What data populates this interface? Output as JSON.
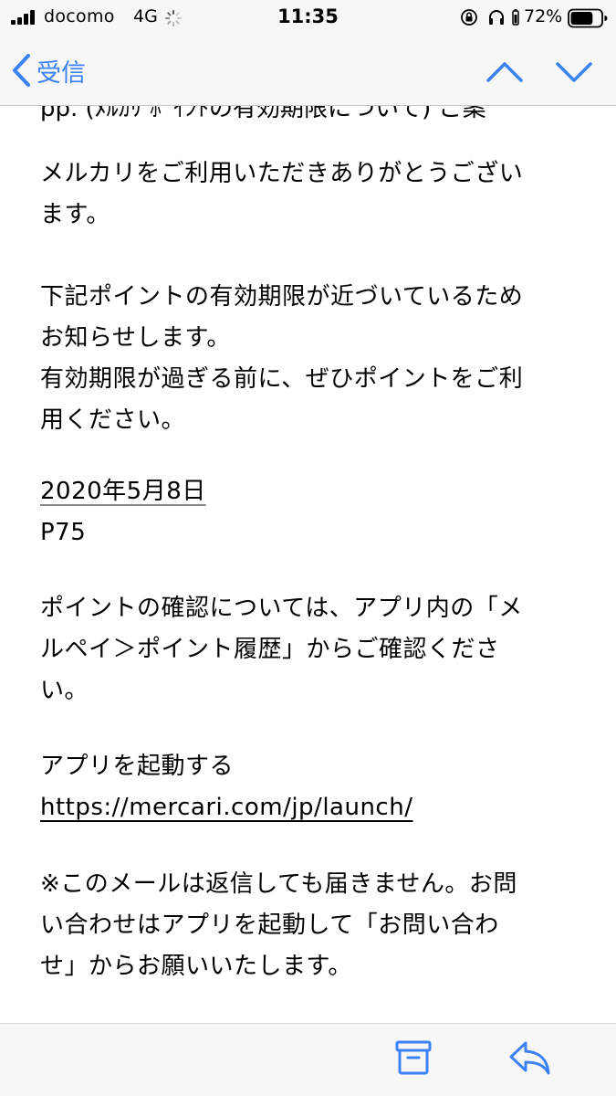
{
  "status_bar": {
    "carrier": "docomo",
    "network": "4G",
    "time": "11:35",
    "battery_percent": "72%",
    "battery_level": 0.72,
    "icons": [
      "signal-icon",
      "activity-icon",
      "orientation-lock-icon",
      "headphones-icon",
      "battery-icon"
    ]
  },
  "nav": {
    "back_label": "受信",
    "back_icon": "chevron-left-icon",
    "up_icon": "chevron-up-icon",
    "down_icon": "chevron-down-icon",
    "accent_color": "#3b82f6"
  },
  "mail": {
    "partial_top_line": "pp. (ﾒﾙｶﾘ ﾎﾟｲﾝﾄの有効期限について) ご案",
    "greeting": [
      "メルカリをご利用いただきありがとうござい",
      "ます。"
    ],
    "notice": [
      "下記ポイントの有効期限が近づいているため",
      "お知らせします。",
      "有効期限が過ぎる前に、ぜひポイントをご利",
      "用ください。"
    ],
    "expiry_date": "2020年5月8日",
    "points": "P75",
    "confirm": [
      "ポイントの確認については、アプリ内の「メ",
      "ルペイ＞ポイント履歴」からご確認くださ",
      "い。"
    ],
    "launch_label": "アプリを起動する",
    "launch_url": "https://mercari.com/jp/launch/",
    "footer": [
      "※このメールは返信しても届きません。お問",
      "い合わせはアプリを起動して「お問い合わ",
      "せ」からお願いいたします。"
    ]
  },
  "toolbar": {
    "archive_icon": "archive-icon",
    "reply_icon": "reply-icon"
  }
}
